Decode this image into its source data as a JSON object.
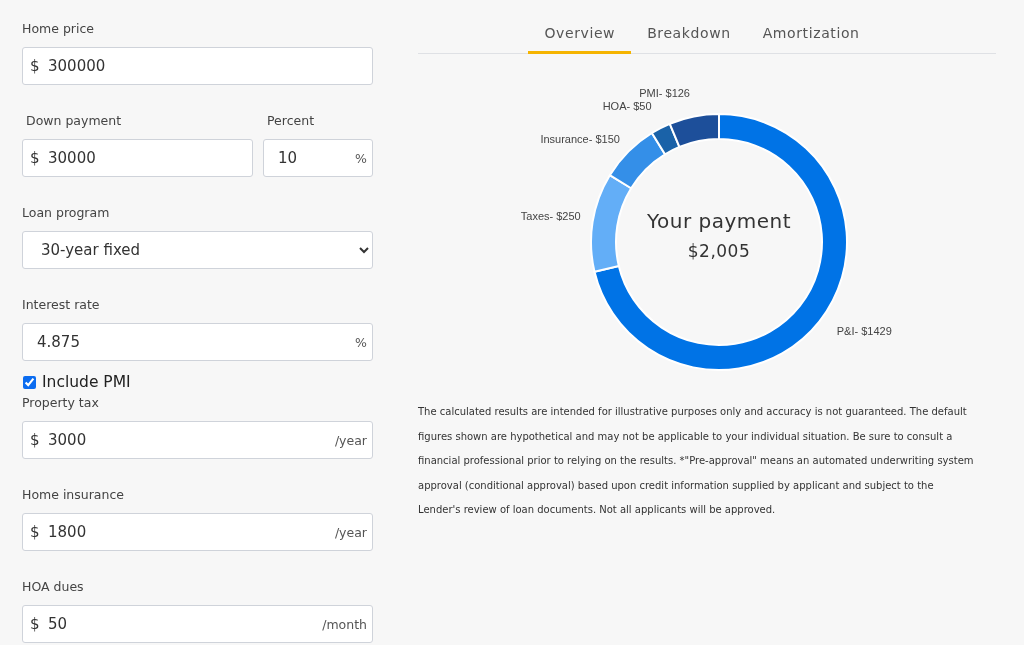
{
  "form": {
    "home_price": {
      "label": "Home price",
      "prefix": "$",
      "value": "300000"
    },
    "down_payment": {
      "label": "Down payment",
      "prefix": "$",
      "value": "30000"
    },
    "percent": {
      "label": "Percent",
      "value": "10",
      "suffix": "%"
    },
    "loan_program": {
      "label": "Loan program",
      "value": "30-year fixed"
    },
    "interest_rate": {
      "label": "Interest rate",
      "value": "4.875",
      "suffix": "%"
    },
    "include_pmi": {
      "label": "Include PMI",
      "checked": true
    },
    "property_tax": {
      "label": "Property tax",
      "prefix": "$",
      "value": "3000",
      "suffix": "/year"
    },
    "home_insurance": {
      "label": "Home insurance",
      "prefix": "$",
      "value": "1800",
      "suffix": "/year"
    },
    "hoa_dues": {
      "label": "HOA dues",
      "prefix": "$",
      "value": "50",
      "suffix": "/month"
    }
  },
  "tabs": [
    {
      "label": "Overview",
      "selected": true
    },
    {
      "label": "Breakdown",
      "selected": false
    },
    {
      "label": "Amortization",
      "selected": false
    }
  ],
  "payment": {
    "title": "Your payment",
    "amount": "$2,005",
    "chart_data": {
      "type": "donut",
      "categories": [
        "P&I- $1429",
        "Taxes- $250",
        "Insurance- $150",
        "HOA- $50",
        "PMI- $126"
      ],
      "values": [
        71.27,
        12.47,
        7.48,
        2.5,
        6.28
      ],
      "colors": [
        "#0073e6",
        "#63aef7",
        "#348fe8",
        "#1a62a8",
        "#1d4f9a"
      ]
    }
  },
  "disclaimer": "The calculated results are intended for illustrative purposes only and accuracy is not guaranteed. The default figures shown are hypothetical and may not be applicable to your individual situation. Be sure to consult a financial professional prior to relying on the results. *\"Pre-approval\" means an automated underwriting system approval (conditional approval) based upon credit information supplied by applicant and subject to the Lender's review of loan documents. Not all applicants will be approved."
}
